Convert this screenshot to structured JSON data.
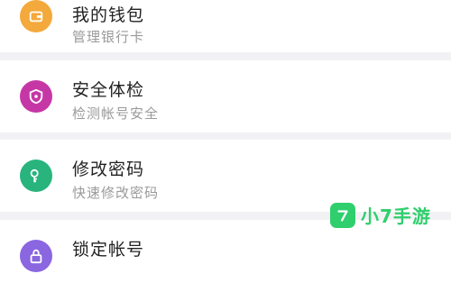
{
  "items": [
    {
      "title": "我的钱包",
      "subtitle": "管理银行卡",
      "icon": "wallet-icon",
      "color": "#f3a93b"
    },
    {
      "title": "安全体检",
      "subtitle": "检测帐号安全",
      "icon": "shield-icon",
      "color": "#c637a6"
    },
    {
      "title": "修改密码",
      "subtitle": "快速修改密码",
      "icon": "key-icon",
      "color": "#28b47c"
    },
    {
      "title": "锁定帐号",
      "subtitle": "",
      "icon": "lock-icon",
      "color": "#8a66e0"
    }
  ],
  "watermark": {
    "text": "小7手游",
    "color": "#2ecf6c"
  }
}
